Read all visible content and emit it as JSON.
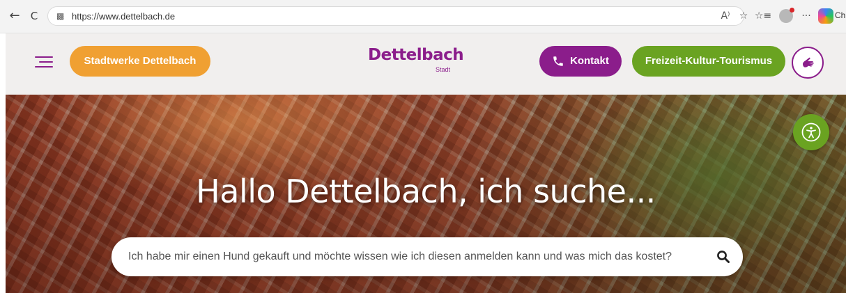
{
  "browser": {
    "url": "https://www.dettelbach.de",
    "back_icon": "←",
    "refresh_icon": "C",
    "lock_icon": "lock-icon",
    "read_aloud_icon": "A⁾",
    "favorite_icon": "☆",
    "collections_icon": "☆≡",
    "more_icon": "···",
    "copilot_label": "Ch"
  },
  "header": {
    "menu_icon": "hamburger-menu-icon",
    "stadtwerke_label": "Stadtwerke Dettelbach",
    "logo_name": "Dettelbach",
    "logo_sub": "Stadt",
    "kontakt_label": "Kontakt",
    "freizeit_label": "Freizeit-Kultur-Tourismus",
    "colors": {
      "purple": "#8b1d8b",
      "orange": "#f0a032",
      "green": "#6aa321"
    }
  },
  "hero": {
    "title": "Hallo Dettelbach, ich suche...",
    "search_placeholder": "Ich habe mir einen Hund gekauft und möchte wissen wie ich diesen anmelden kann und was mich das kostet?",
    "search_icon": "search-icon",
    "accessibility_icon": "accessibility-icon"
  }
}
